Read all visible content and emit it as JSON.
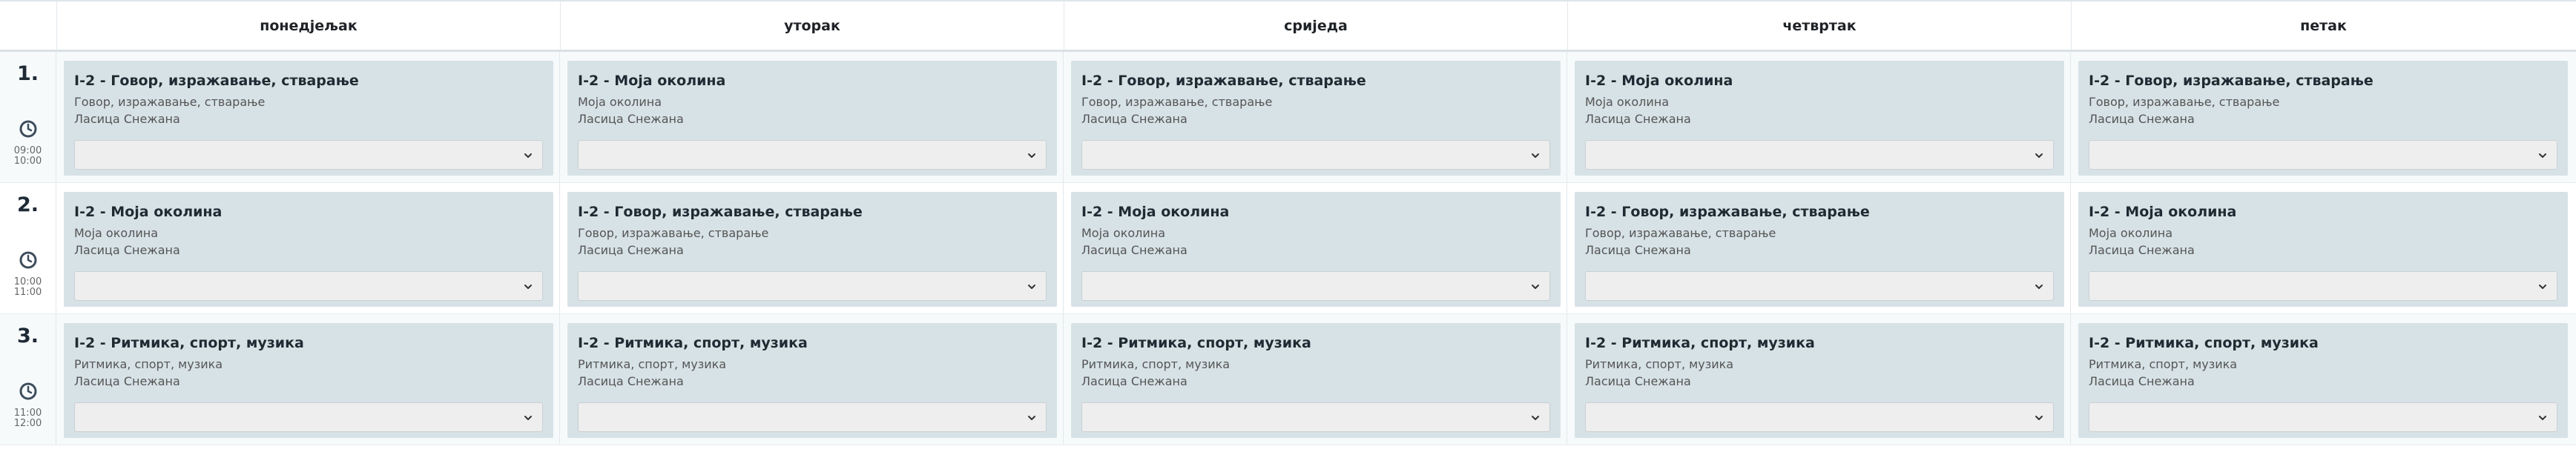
{
  "days": [
    "понедјељак",
    "уторак",
    "сриједа",
    "четвртак",
    "петак"
  ],
  "periods": [
    {
      "number": "1.",
      "start": "09:00",
      "end": "10:00"
    },
    {
      "number": "2.",
      "start": "10:00",
      "end": "11:00"
    },
    {
      "number": "3.",
      "start": "11:00",
      "end": "12:00"
    }
  ],
  "lessons": [
    [
      {
        "title": "I-2 - Говор, изражавање, стварање",
        "subject": "Говор, изражавање, стварање",
        "teacher": "Ласица Снежана",
        "selected": ""
      },
      {
        "title": "I-2 - Моја околина",
        "subject": "Моја околина",
        "teacher": "Ласица Снежана",
        "selected": ""
      },
      {
        "title": "I-2 - Говор, изражавање, стварање",
        "subject": "Говор, изражавање, стварање",
        "teacher": "Ласица Снежана",
        "selected": ""
      },
      {
        "title": "I-2 - Моја околина",
        "subject": "Моја околина",
        "teacher": "Ласица Снежана",
        "selected": ""
      },
      {
        "title": "I-2 - Говор, изражавање, стварање",
        "subject": "Говор, изражавање, стварање",
        "teacher": "Ласица Снежана",
        "selected": ""
      }
    ],
    [
      {
        "title": "I-2 - Моја околина",
        "subject": "Моја околина",
        "teacher": "Ласица Снежана",
        "selected": ""
      },
      {
        "title": "I-2 - Говор, изражавање, стварање",
        "subject": "Говор, изражавање, стварање",
        "teacher": "Ласица Снежана",
        "selected": ""
      },
      {
        "title": "I-2 - Моја околина",
        "subject": "Моја околина",
        "teacher": "Ласица Снежана",
        "selected": ""
      },
      {
        "title": "I-2 - Говор, изражавање, стварање",
        "subject": "Говор, изражавање, стварање",
        "teacher": "Ласица Снежана",
        "selected": ""
      },
      {
        "title": "I-2 - Моја околина",
        "subject": "Моја околина",
        "teacher": "Ласица Снежана",
        "selected": ""
      }
    ],
    [
      {
        "title": "I-2 - Ритмика, спорт, музика",
        "subject": "Ритмика, спорт, музика",
        "teacher": "Ласица Снежана",
        "selected": ""
      },
      {
        "title": "I-2 - Ритмика, спорт, музика",
        "subject": "Ритмика, спорт, музика",
        "teacher": "Ласица Снежана",
        "selected": ""
      },
      {
        "title": "I-2 - Ритмика, спорт, музика",
        "subject": "Ритмика, спорт, музика",
        "teacher": "Ласица Снежана",
        "selected": ""
      },
      {
        "title": "I-2 - Ритмика, спорт, музика",
        "subject": "Ритмика, спорт, музика",
        "teacher": "Ласица Снежана",
        "selected": ""
      },
      {
        "title": "I-2 - Ритмика, спорт, музика",
        "subject": "Ритмика, спорт, музика",
        "teacher": "Ласица Снежана",
        "selected": ""
      }
    ]
  ],
  "icons": {
    "clock": "clock-icon",
    "dropdown": "chevron-down-icon"
  },
  "colors": {
    "card_bg": "#d7e2e6",
    "select_bg": "#eeeeee",
    "header_border": "#d9e1e6"
  }
}
